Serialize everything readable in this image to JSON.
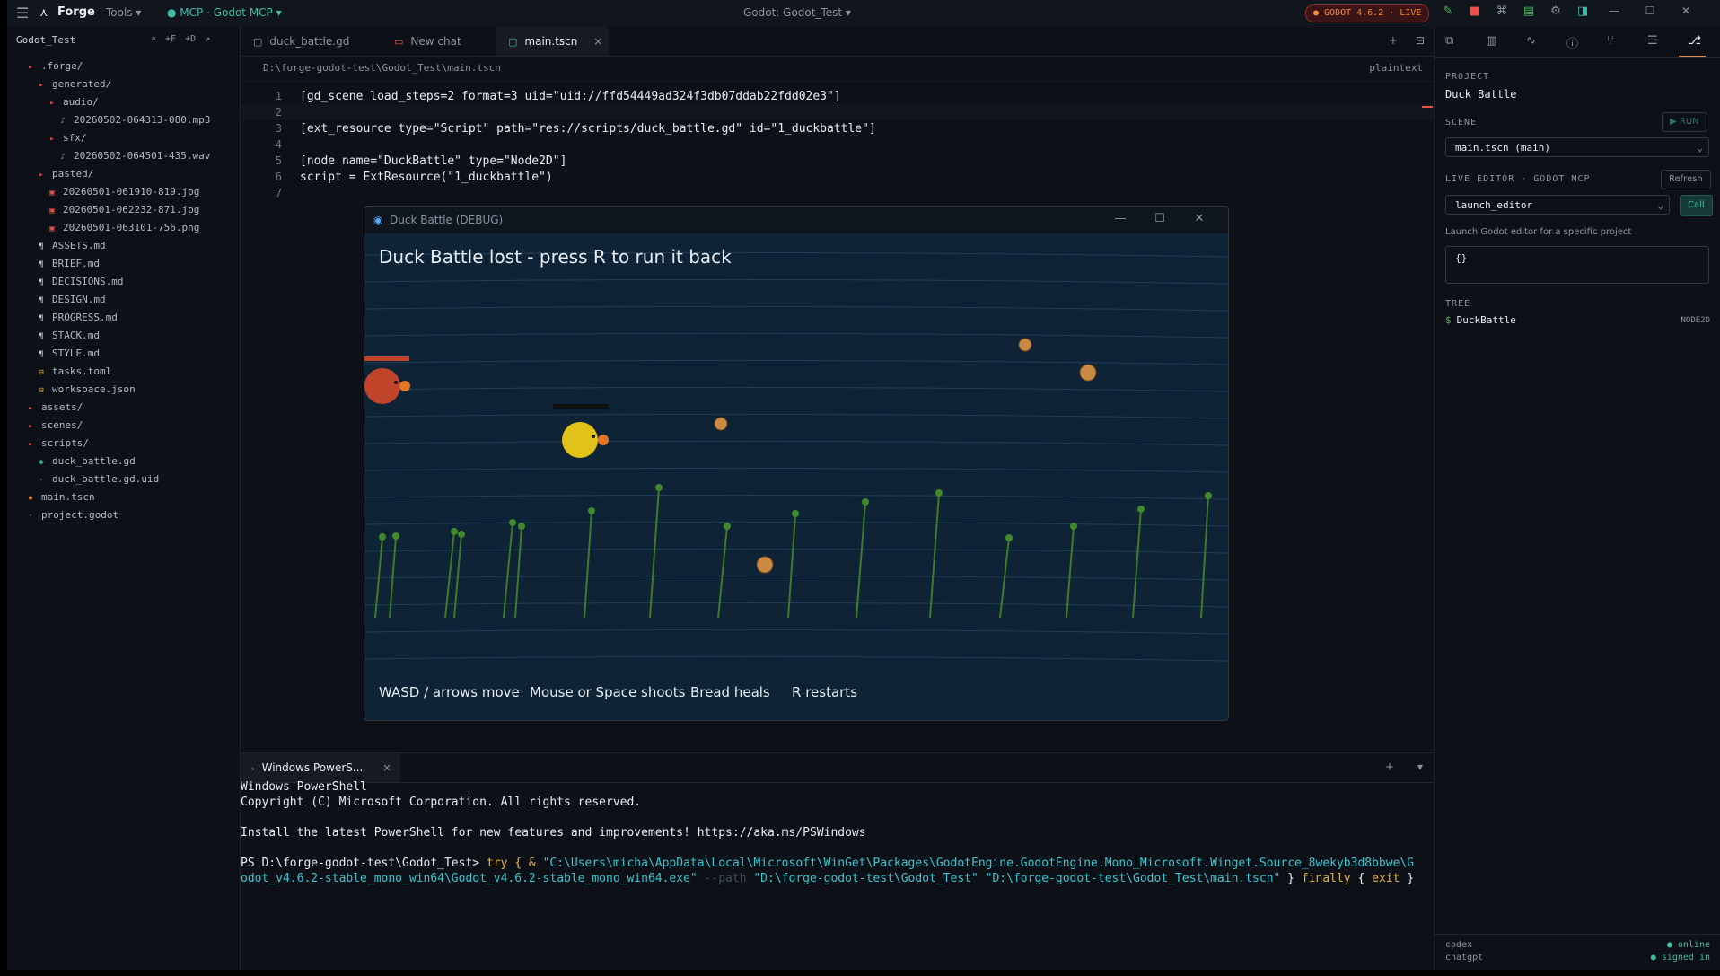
{
  "topbar": {
    "menu_icon": "☰",
    "app_name": "Forge",
    "tools_label": "Tools ▾",
    "mcp_label": "● MCP · Godot MCP ▾",
    "window_title": "Godot: Godot_Test ▾",
    "live_badge": "● GODOT 4.6.2 · LIVE",
    "win_min": "—",
    "win_max": "☐",
    "win_close": "✕"
  },
  "sidebar": {
    "project": "Godot_Test",
    "actions": [
      "⌕",
      "+F",
      "+D",
      "↗"
    ],
    "files": [
      {
        "name": ".forge/",
        "depth": 1,
        "kind": "folder"
      },
      {
        "name": "generated/",
        "depth": 2,
        "kind": "folder"
      },
      {
        "name": "audio/",
        "depth": 3,
        "kind": "folder"
      },
      {
        "name": "20260502-064313-080.mp3",
        "depth": 4,
        "kind": "audio"
      },
      {
        "name": "sfx/",
        "depth": 3,
        "kind": "folder"
      },
      {
        "name": "20260502-064501-435.wav",
        "depth": 4,
        "kind": "audio"
      },
      {
        "name": "pasted/",
        "depth": 2,
        "kind": "folder"
      },
      {
        "name": "20260501-061910-819.jpg",
        "depth": 3,
        "kind": "image"
      },
      {
        "name": "20260501-062232-871.jpg",
        "depth": 3,
        "kind": "image"
      },
      {
        "name": "20260501-063101-756.png",
        "depth": 3,
        "kind": "image"
      },
      {
        "name": "ASSETS.md",
        "depth": 2,
        "kind": "md"
      },
      {
        "name": "BRIEF.md",
        "depth": 2,
        "kind": "md"
      },
      {
        "name": "DECISIONS.md",
        "depth": 2,
        "kind": "md"
      },
      {
        "name": "DESIGN.md",
        "depth": 2,
        "kind": "md"
      },
      {
        "name": "PROGRESS.md",
        "depth": 2,
        "kind": "md"
      },
      {
        "name": "STACK.md",
        "depth": 2,
        "kind": "md"
      },
      {
        "name": "STYLE.md",
        "depth": 2,
        "kind": "md"
      },
      {
        "name": "tasks.toml",
        "depth": 2,
        "kind": "config"
      },
      {
        "name": "workspace.json",
        "depth": 2,
        "kind": "config"
      },
      {
        "name": "assets/",
        "depth": 1,
        "kind": "folder"
      },
      {
        "name": "scenes/",
        "depth": 1,
        "kind": "folder"
      },
      {
        "name": "scripts/",
        "depth": 1,
        "kind": "folder"
      },
      {
        "name": "duck_battle.gd",
        "depth": 2,
        "kind": "gd"
      },
      {
        "name": "duck_battle.gd.uid",
        "depth": 2,
        "kind": "uid"
      },
      {
        "name": "main.tscn",
        "depth": 1,
        "kind": "scene"
      },
      {
        "name": "project.godot",
        "depth": 1,
        "kind": "plain"
      }
    ]
  },
  "editor": {
    "tabs": [
      {
        "label": "duck_battle.gd",
        "icon": "▢",
        "active": false,
        "closable": false
      },
      {
        "label": "New chat",
        "icon": "▭",
        "active": false,
        "closable": false
      },
      {
        "label": "main.tscn",
        "icon": "▢",
        "active": true,
        "closable": true
      }
    ],
    "tab_close": "×",
    "tab_actions": [
      "+",
      "⊟"
    ],
    "path": "D:\\forge-godot-test\\Godot_Test\\main.tscn",
    "language": "plaintext",
    "lines": [
      "[gd_scene load_steps=2 format=3 uid=\"uid://ffd54449ad324f3db07ddab22fdd02e3\"]",
      "",
      "[ext_resource type=\"Script\" path=\"res://scripts/duck_battle.gd\" id=\"1_duckbattle\"]",
      "",
      "[node name=\"DuckBattle\" type=\"Node2D\"]",
      "script = ExtResource(\"1_duckbattle\")",
      ""
    ],
    "line_numbers": [
      "1",
      "2",
      "3",
      "4",
      "5",
      "6",
      "7"
    ]
  },
  "game": {
    "title": "Duck Battle (DEBUG)",
    "message": "Duck Battle lost - press R to run it back",
    "hints": [
      "WASD / arrows move",
      "Mouse or Space shoots",
      "Bread heals",
      "R restarts"
    ],
    "colors": {
      "background": "#0f2336",
      "player_duck": "#e0c21a",
      "enemy_duck": "#c0442a",
      "bread": "#c98a44",
      "reeds": "#3d7a2a"
    }
  },
  "terminal": {
    "tab_label": "Windows PowerS...",
    "tab_close": "×",
    "actions": [
      "+",
      "▾"
    ],
    "lines": [
      "Windows PowerShell",
      "Copyright (C) Microsoft Corporation. All rights reserved.",
      "",
      "Install the latest PowerShell for new features and improvements! https://aka.ms/PSWindows",
      ""
    ],
    "prompt": "PS D:\\forge-godot-test\\Godot_Test> ",
    "cmd_try": "try { & ",
    "cmd_path1": "\"C:\\Users\\micha\\AppData\\Local\\Microsoft\\WinGet\\Packages\\GodotEngine.GodotEngine.Mono_Microsoft.Winget.Source_8wekyb3d8bbwe\\G",
    "cmd_path2": "odot_v4.6.2-stable_mono_win64\\Godot_v4.6.2-stable_mono_win64.exe\"",
    "cmd_flag": " --path ",
    "cmd_args": "\"D:\\forge-godot-test\\Godot_Test\" \"D:\\forge-godot-test\\Godot_Test\\main.tscn\"",
    "cmd_close": " } ",
    "cmd_finally": "finally",
    "cmd_exit_open": " { ",
    "cmd_exit": "exit",
    "cmd_end": " }"
  },
  "right_panel": {
    "project_label": "PROJECT",
    "project_name": "Duck Battle",
    "scene_label": "SCENE",
    "run_button": "▶ RUN",
    "scene_value": "main.tscn (main)",
    "live_label": "LIVE EDITOR · GODOT MCP",
    "refresh_button": "Refresh",
    "tool_value": "launch_editor",
    "call_button": "Call",
    "tool_description": "Launch Godot editor for a specific project",
    "args_value": "{}",
    "tree_label": "TREE",
    "tree_node_icon": "$",
    "tree_node": "DuckBattle",
    "tree_node_type": "NODE2D",
    "footer": [
      {
        "name": "codex",
        "status": "● online"
      },
      {
        "name": "chatgpt",
        "status": "● signed in"
      }
    ]
  },
  "colors": {
    "accent": "#3fb9a8",
    "live": "#f0883e",
    "danger": "#e5534b",
    "background": "#0d1117"
  }
}
